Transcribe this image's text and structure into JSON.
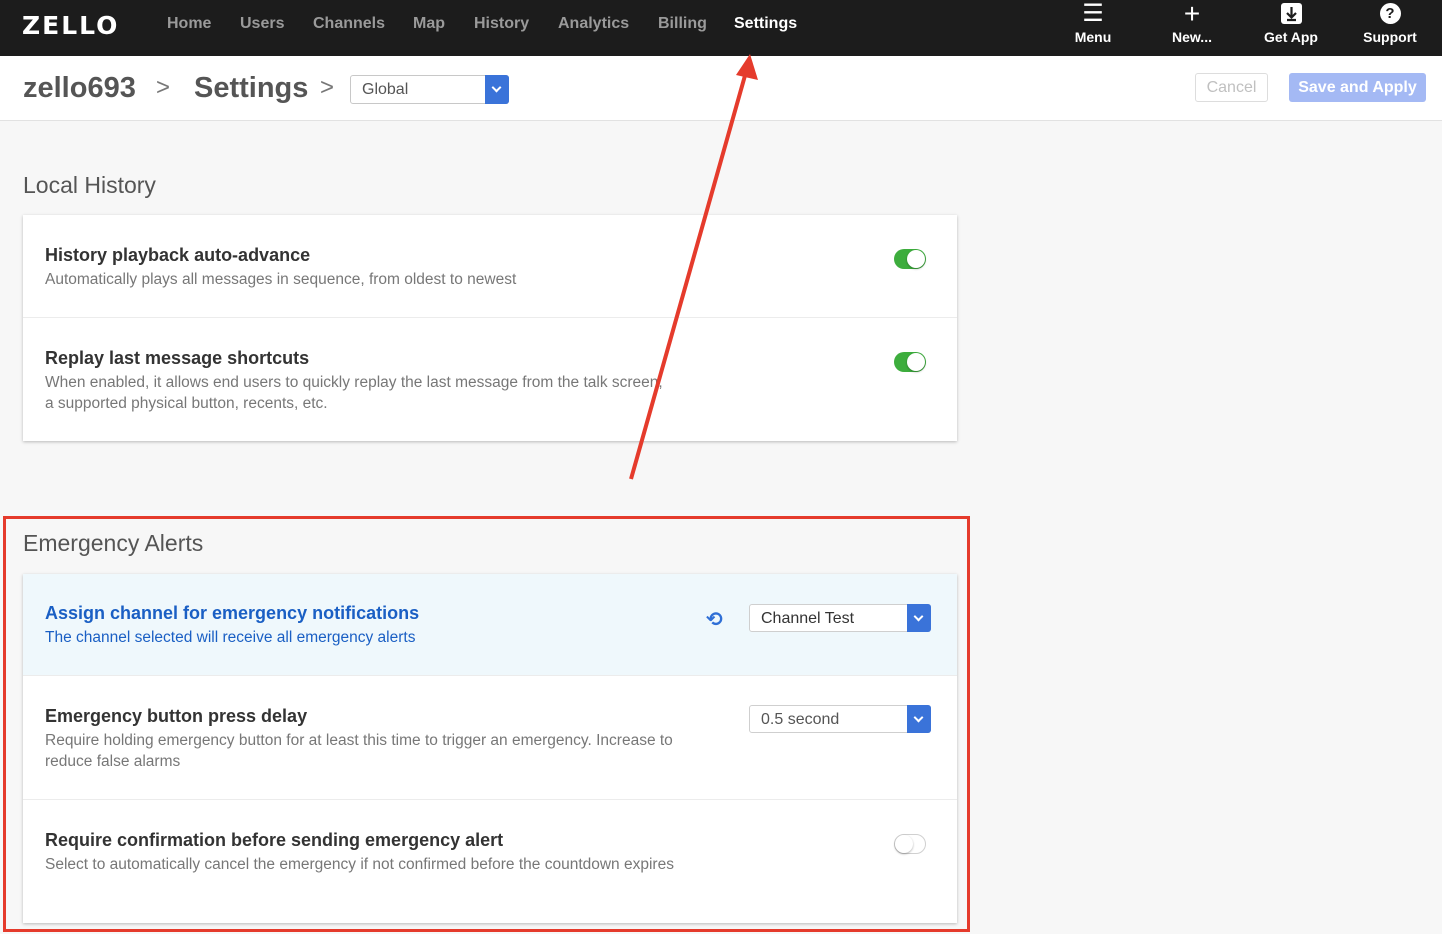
{
  "topbar": {
    "logo": "ZELLO",
    "nav": [
      {
        "label": "Home"
      },
      {
        "label": "Users"
      },
      {
        "label": "Channels"
      },
      {
        "label": "Map"
      },
      {
        "label": "History"
      },
      {
        "label": "Analytics"
      },
      {
        "label": "Billing"
      },
      {
        "label": "Settings",
        "active": true
      }
    ],
    "actions": [
      {
        "label": "Menu",
        "icon": "menu-icon"
      },
      {
        "label": "New...",
        "icon": "plus-icon"
      },
      {
        "label": "Get App",
        "icon": "download-icon"
      },
      {
        "label": "Support",
        "icon": "help-icon"
      }
    ]
  },
  "header": {
    "account": "zello693",
    "page": "Settings",
    "scope_value": "Global",
    "cancel_label": "Cancel",
    "save_label": "Save and Apply"
  },
  "local_history": {
    "title": "Local History",
    "rows": [
      {
        "title": "History playback auto-advance",
        "desc": "Automatically plays all messages in sequence, from oldest to newest",
        "enabled": true
      },
      {
        "title": "Replay last message shortcuts",
        "desc": "When enabled, it allows end users to quickly replay the last message from the talk screen, a supported physical button, recents, etc.",
        "enabled": true
      }
    ]
  },
  "emergency_alerts": {
    "title": "Emergency Alerts",
    "rows": [
      {
        "title": "Assign channel for emergency notifications",
        "desc": "The channel selected will receive all emergency alerts",
        "value": "Channel Test"
      },
      {
        "title": "Emergency button press delay",
        "desc": "Require holding emergency button for at least this time to trigger an emergency. Increase to reduce false alarms",
        "value": "0.5 second"
      },
      {
        "title": "Require confirmation before sending emergency alert",
        "desc": "Select to automatically cancel the emergency if not confirmed before the countdown expires",
        "enabled": false
      }
    ]
  },
  "colors": {
    "accent": "#3a73d9",
    "toggle_on": "#3dad3d",
    "annotation": "#e53b2c",
    "highlight_text": "#1a5fc4"
  }
}
